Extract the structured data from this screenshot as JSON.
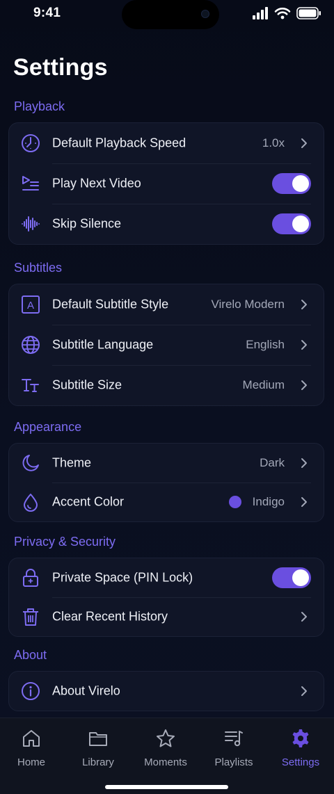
{
  "status_bar": {
    "time": "9:41",
    "icons": [
      "cellular-signal-icon",
      "wifi-icon",
      "battery-icon"
    ]
  },
  "page": {
    "title": "Settings"
  },
  "colors": {
    "accent": "#6a4fe0",
    "accent_text": "#7d6cf2",
    "background": "#070b18",
    "card": "#101527"
  },
  "sections": {
    "playback": {
      "header": "Playback",
      "default_speed": {
        "label": "Default Playback Speed",
        "value": "1.0x",
        "icon": "speed-gauge-icon"
      },
      "play_next": {
        "label": "Play Next Video",
        "enabled": true,
        "icon": "play-queue-icon"
      },
      "skip_silence": {
        "label": "Skip Silence",
        "enabled": true,
        "icon": "waveform-icon"
      }
    },
    "subtitles": {
      "header": "Subtitles",
      "style": {
        "label": "Default Subtitle Style",
        "value": "Virelo Modern",
        "icon": "letter-a-box-icon"
      },
      "language": {
        "label": "Subtitle Language",
        "value": "English",
        "icon": "globe-icon"
      },
      "size": {
        "label": "Subtitle Size",
        "value": "Medium",
        "icon": "text-size-icon"
      }
    },
    "appearance": {
      "header": "Appearance",
      "theme": {
        "label": "Theme",
        "value": "Dark",
        "icon": "moon-icon"
      },
      "accent_color": {
        "label": "Accent Color",
        "value": "Indigo",
        "swatch": "#6a4fe0",
        "icon": "droplet-icon"
      }
    },
    "privacy": {
      "header": "Privacy & Security",
      "private_space": {
        "label": "Private Space (PIN Lock)",
        "enabled": true,
        "icon": "lock-icon"
      },
      "clear_history": {
        "label": "Clear Recent History",
        "icon": "trash-icon"
      }
    },
    "about": {
      "header": "About",
      "about_app": {
        "label": "About Virelo",
        "icon": "info-icon"
      }
    }
  },
  "tab_bar": {
    "active": "Settings",
    "tabs": [
      {
        "label": "Home",
        "icon": "home-icon"
      },
      {
        "label": "Library",
        "icon": "folder-icon"
      },
      {
        "label": "Moments",
        "icon": "star-icon"
      },
      {
        "label": "Playlists",
        "icon": "playlist-icon"
      },
      {
        "label": "Settings",
        "icon": "gear-icon"
      }
    ]
  }
}
